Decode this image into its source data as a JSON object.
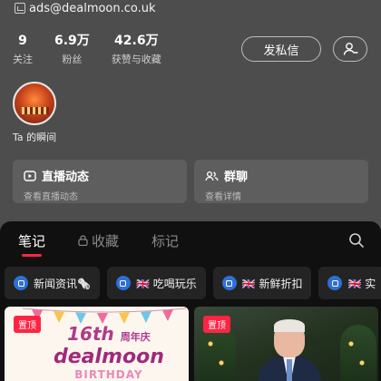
{
  "profile": {
    "email": "ads@dealmoon.co.uk",
    "stats": [
      {
        "value": "9",
        "label": "关注"
      },
      {
        "value": "6.9万",
        "label": "粉丝"
      },
      {
        "value": "42.6万",
        "label": "获赞与收藏"
      }
    ],
    "message_button": "发私信",
    "moment_label": "Ta 的瞬间"
  },
  "cards": {
    "live": {
      "title": "直播动态",
      "subtitle": "查看直播动态"
    },
    "group": {
      "title": "群聊",
      "subtitle": "查看详情"
    }
  },
  "tabs": [
    {
      "label": "笔记",
      "active": true
    },
    {
      "label": "收藏",
      "active": false,
      "locked": true
    },
    {
      "label": "标记",
      "active": false
    }
  ],
  "chips": [
    {
      "label": "新闻资讯🗞️"
    },
    {
      "label": "🇬🇧 吃喝玩乐"
    },
    {
      "label": "🇬🇧 新鲜折扣"
    },
    {
      "label": "🇬🇧 实"
    }
  ],
  "posts": [
    {
      "badge": "置顶",
      "logo_16": "16th",
      "logo_anniv": "周年庆",
      "logo_name": "dealmoon",
      "logo_birthday": "BIRTHDAY"
    },
    {
      "badge": "置顶"
    }
  ],
  "colors": {
    "accent": "#ff2442",
    "chip_icon": "#2f6fd6",
    "sheet_bg": "#101010",
    "header_bg": "#4d4d4d"
  },
  "icons": {
    "follow": "add-user-icon",
    "search": "search-icon",
    "live": "live-video-icon",
    "group": "group-icon",
    "lock": "lock-icon"
  }
}
